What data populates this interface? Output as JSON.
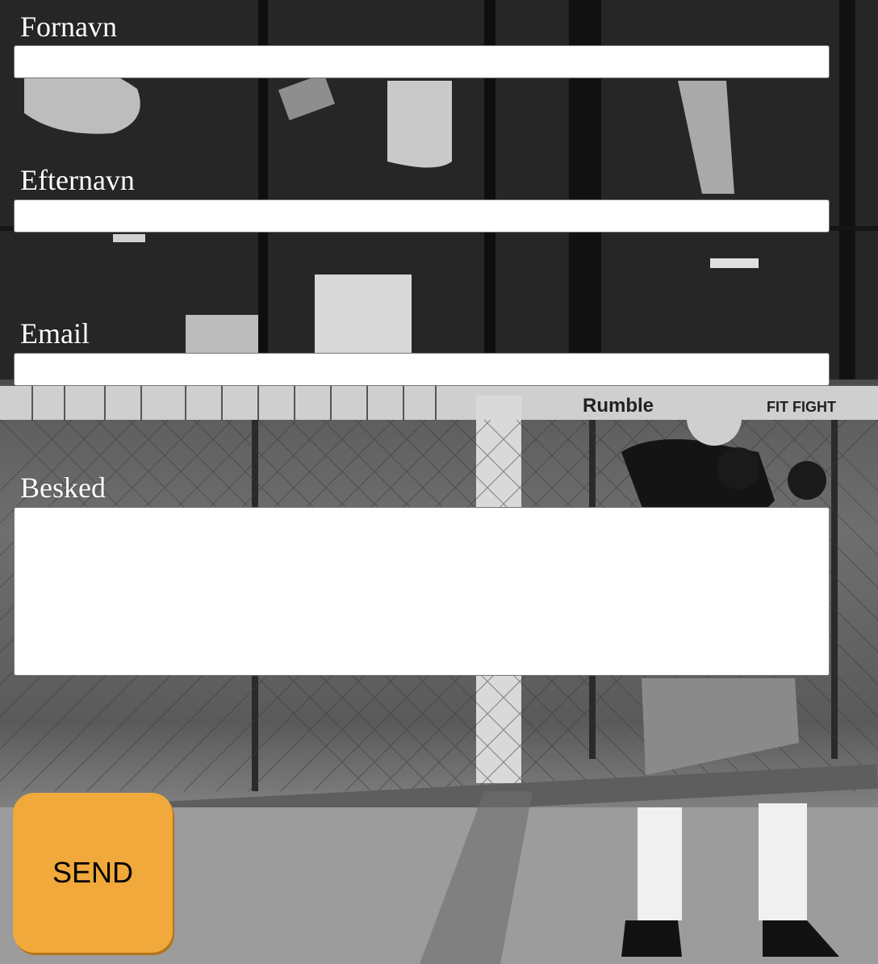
{
  "form": {
    "first_name": {
      "label": "Fornavn",
      "value": ""
    },
    "last_name": {
      "label": "Efternavn",
      "value": ""
    },
    "email": {
      "label": "Email",
      "value": ""
    },
    "message": {
      "label": "Besked",
      "value": ""
    },
    "submit_label": "SEND"
  },
  "colors": {
    "label_text": "#ffffff",
    "button_bg": "#f0a93a",
    "input_bg": "#ffffff"
  }
}
